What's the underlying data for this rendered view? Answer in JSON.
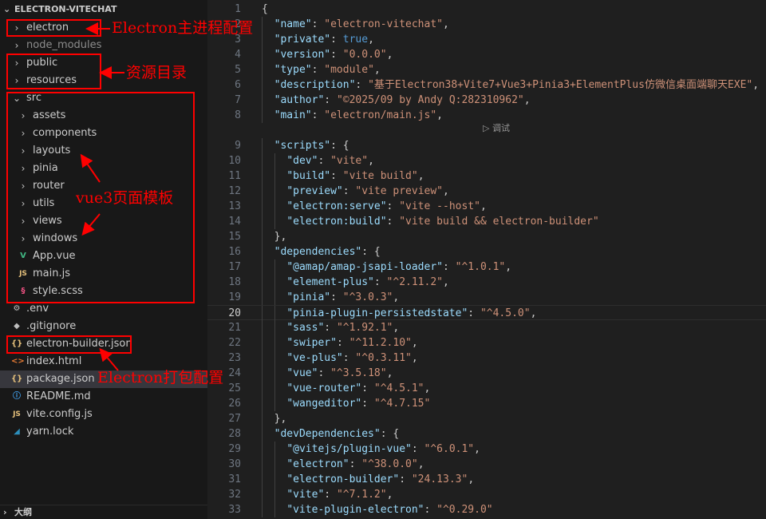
{
  "explorer": {
    "project_title": "ELECTRON-VITECHAT",
    "outline_title": "大纲",
    "items": [
      {
        "label": "electron",
        "kind": "folder",
        "depth": 0,
        "name": "folder-electron"
      },
      {
        "label": "node_modules",
        "kind": "folder",
        "depth": 0,
        "name": "folder-node-modules"
      },
      {
        "label": "public",
        "kind": "folder",
        "depth": 0,
        "name": "folder-public"
      },
      {
        "label": "resources",
        "kind": "folder",
        "depth": 0,
        "name": "folder-resources"
      },
      {
        "label": "src",
        "kind": "folder-open",
        "depth": 0,
        "name": "folder-src"
      },
      {
        "label": "assets",
        "kind": "folder",
        "depth": 1,
        "name": "folder-assets"
      },
      {
        "label": "components",
        "kind": "folder",
        "depth": 1,
        "name": "folder-components"
      },
      {
        "label": "layouts",
        "kind": "folder",
        "depth": 1,
        "name": "folder-layouts"
      },
      {
        "label": "pinia",
        "kind": "folder",
        "depth": 1,
        "name": "folder-pinia"
      },
      {
        "label": "router",
        "kind": "folder",
        "depth": 1,
        "name": "folder-router"
      },
      {
        "label": "utils",
        "kind": "folder",
        "depth": 1,
        "name": "folder-utils"
      },
      {
        "label": "views",
        "kind": "folder",
        "depth": 1,
        "name": "folder-views"
      },
      {
        "label": "windows",
        "kind": "folder",
        "depth": 1,
        "name": "folder-windows"
      },
      {
        "label": "App.vue",
        "kind": "file",
        "icon": "vue-icon",
        "depth": 1,
        "name": "file-app-vue"
      },
      {
        "label": "main.js",
        "kind": "file",
        "icon": "js-icon",
        "depth": 1,
        "name": "file-main-js"
      },
      {
        "label": "style.scss",
        "kind": "file",
        "icon": "scss-icon",
        "depth": 1,
        "name": "file-style-scss"
      },
      {
        "label": ".env",
        "kind": "file",
        "icon": "env-icon",
        "depth": 0,
        "name": "file-env"
      },
      {
        "label": ".gitignore",
        "kind": "file",
        "icon": "git-icon",
        "depth": 0,
        "name": "file-gitignore"
      },
      {
        "label": "electron-builder.json",
        "kind": "file",
        "icon": "json-icon",
        "depth": 0,
        "name": "file-electron-builder-json"
      },
      {
        "label": "index.html",
        "kind": "file",
        "icon": "html-icon",
        "depth": 0,
        "name": "file-index-html"
      },
      {
        "label": "package.json",
        "kind": "file",
        "icon": "json-icon",
        "depth": 0,
        "selected": true,
        "name": "file-package-json"
      },
      {
        "label": "README.md",
        "kind": "file",
        "icon": "markdown-icon",
        "depth": 0,
        "name": "file-readme-md"
      },
      {
        "label": "vite.config.js",
        "kind": "file",
        "icon": "js-icon",
        "depth": 0,
        "name": "file-vite-config-js"
      },
      {
        "label": "yarn.lock",
        "kind": "file",
        "icon": "yarn-icon",
        "depth": 0,
        "name": "file-yarn-lock"
      }
    ]
  },
  "editor": {
    "debug_lens": "▷ 调试",
    "current_line": "20",
    "lines": [
      {
        "n": "1",
        "text": "{"
      },
      {
        "n": "2",
        "text": "  \"name\": \"electron-vitechat\","
      },
      {
        "n": "3",
        "text": "  \"private\": true,"
      },
      {
        "n": "4",
        "text": "  \"version\": \"0.0.0\","
      },
      {
        "n": "5",
        "text": "  \"type\": \"module\","
      },
      {
        "n": "6",
        "text": "  \"description\": \"基于Electron38+Vite7+Vue3+Pinia3+ElementPlus仿微信桌面端聊天EXE\","
      },
      {
        "n": "7",
        "text": "  \"author\": \"©2025/09 by Andy Q:282310962\","
      },
      {
        "n": "8",
        "text": "  \"main\": \"electron/main.js\","
      },
      {
        "n": "9",
        "text": "  \"scripts\": {"
      },
      {
        "n": "10",
        "text": "    \"dev\": \"vite\","
      },
      {
        "n": "11",
        "text": "    \"build\": \"vite build\","
      },
      {
        "n": "12",
        "text": "    \"preview\": \"vite preview\","
      },
      {
        "n": "13",
        "text": "    \"electron:serve\": \"vite --host\","
      },
      {
        "n": "14",
        "text": "    \"electron:build\": \"vite build && electron-builder\""
      },
      {
        "n": "15",
        "text": "  },"
      },
      {
        "n": "16",
        "text": "  \"dependencies\": {"
      },
      {
        "n": "17",
        "text": "    \"@amap/amap-jsapi-loader\": \"^1.0.1\","
      },
      {
        "n": "18",
        "text": "    \"element-plus\": \"^2.11.2\","
      },
      {
        "n": "19",
        "text": "    \"pinia\": \"^3.0.3\","
      },
      {
        "n": "20",
        "text": "    \"pinia-plugin-persistedstate\": \"^4.5.0\","
      },
      {
        "n": "21",
        "text": "    \"sass\": \"^1.92.1\","
      },
      {
        "n": "22",
        "text": "    \"swiper\": \"^11.2.10\","
      },
      {
        "n": "23",
        "text": "    \"ve-plus\": \"^0.3.11\","
      },
      {
        "n": "24",
        "text": "    \"vue\": \"^3.5.18\","
      },
      {
        "n": "25",
        "text": "    \"vue-router\": \"^4.5.1\","
      },
      {
        "n": "26",
        "text": "    \"wangeditor\": \"^4.7.15\""
      },
      {
        "n": "27",
        "text": "  },"
      },
      {
        "n": "28",
        "text": "  \"devDependencies\": {"
      },
      {
        "n": "29",
        "text": "    \"@vitejs/plugin-vue\": \"^6.0.1\","
      },
      {
        "n": "30",
        "text": "    \"electron\": \"^38.0.0\","
      },
      {
        "n": "31",
        "text": "    \"electron-builder\": \"24.13.3\","
      },
      {
        "n": "32",
        "text": "    \"vite\": \"^7.1.2\","
      },
      {
        "n": "33",
        "text": "    \"vite-plugin-electron\": \"^0.29.0\""
      }
    ]
  },
  "annotations": {
    "electron_main": "Electron主进程配置",
    "resources_dir": "资源目录",
    "vue3_templates": "vue3页面模板",
    "electron_packaging": "Electron打包配置",
    "color": "#ff0000"
  }
}
